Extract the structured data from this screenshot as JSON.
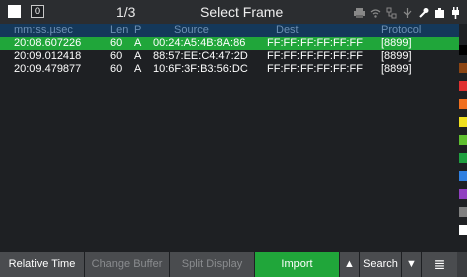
{
  "header": {
    "frame_position": "1/3",
    "title": "Select Frame",
    "badge": "0",
    "status_icons": [
      "printer-icon",
      "wifi-icon",
      "network-icon",
      "usb-icon",
      "wrench-icon",
      "battery-icon",
      "power-plug-icon"
    ]
  },
  "table": {
    "columns": {
      "timestamp": "mm:ss.µsec",
      "len": "Len",
      "p": "P",
      "source": "Source",
      "dest": "Dest",
      "protocol": "Protocol"
    },
    "rows": [
      {
        "timestamp": "20:08.607226",
        "len": "60",
        "p": "A",
        "source": "00:24:A5:4B:8A:86",
        "dest": "FF:FF:FF:FF:FF:FF",
        "protocol": "[8899]"
      },
      {
        "timestamp": "20:09.012418",
        "len": "60",
        "p": "A",
        "source": "88:57:EE:C4:47:2D",
        "dest": "FF:FF:FF:FF:FF:FF",
        "protocol": "[8899]"
      },
      {
        "timestamp": "20:09.479877",
        "len": "60",
        "p": "A",
        "source": "10:6F:3F:B3:56:DC",
        "dest": "FF:FF:FF:FF:FF:FF",
        "protocol": "[8899]"
      }
    ],
    "selected_row": 0
  },
  "legend_colors": [
    "#000000",
    "#8b4513",
    "#e03030",
    "#f07020",
    "#f0e020",
    "#60c030",
    "#20a040",
    "#3080e0",
    "#9040c0",
    "#808080",
    "#ffffff"
  ],
  "footer": {
    "relative_time": "Relative Time",
    "change_buffer": "Change Buffer",
    "split_display": "Split Display",
    "import": "Import",
    "up_arrow": "▲",
    "search": "Search",
    "down_arrow": "▼",
    "menu": "≣"
  },
  "colors": {
    "selected_row": "#20a63a",
    "header_bg": "#14385a",
    "background": "#1e2023"
  }
}
